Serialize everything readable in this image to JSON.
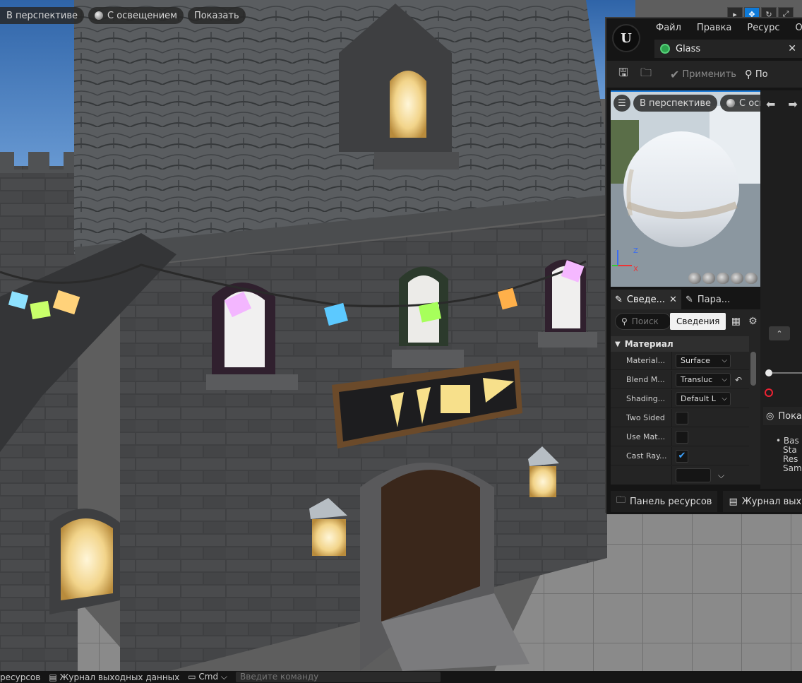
{
  "viewport": {
    "view_mode": "В перспективе",
    "lighting": "С освещением",
    "show": "Показать"
  },
  "material_editor": {
    "menu": [
      "Файл",
      "Правка",
      "Ресурс",
      "Окно"
    ],
    "tab_title": "Glass",
    "toolbar": {
      "apply": "Применить",
      "search": "По"
    },
    "preview": {
      "view_mode": "В перспективе",
      "lighting": "С осв"
    },
    "details_tabs": [
      {
        "label": "Сведе..."
      },
      {
        "label": "Пара..."
      }
    ],
    "search_placeholder": "Поиск",
    "tooltip": "Сведения",
    "section_title": "Материал",
    "properties": [
      {
        "label": "Material...",
        "value": "Surface"
      },
      {
        "label": "Blend M...",
        "value": "Transluc"
      },
      {
        "label": "Shading...",
        "value": "Default L"
      },
      {
        "label": "Two Sided",
        "checked": false
      },
      {
        "label": "Use Mat...",
        "checked": false
      },
      {
        "label": "Cast Ray...",
        "checked": true
      }
    ],
    "show_panel": "Пока",
    "bullets": [
      "Bas",
      "Sta",
      "Res",
      "Sam"
    ],
    "bottom_tabs": [
      "Панель ресурсов",
      "Журнал выходны"
    ]
  },
  "statusbar": {
    "items": [
      "ресурсов",
      "Журнал выходных данных",
      "Cmd",
      "Введите команду"
    ]
  }
}
